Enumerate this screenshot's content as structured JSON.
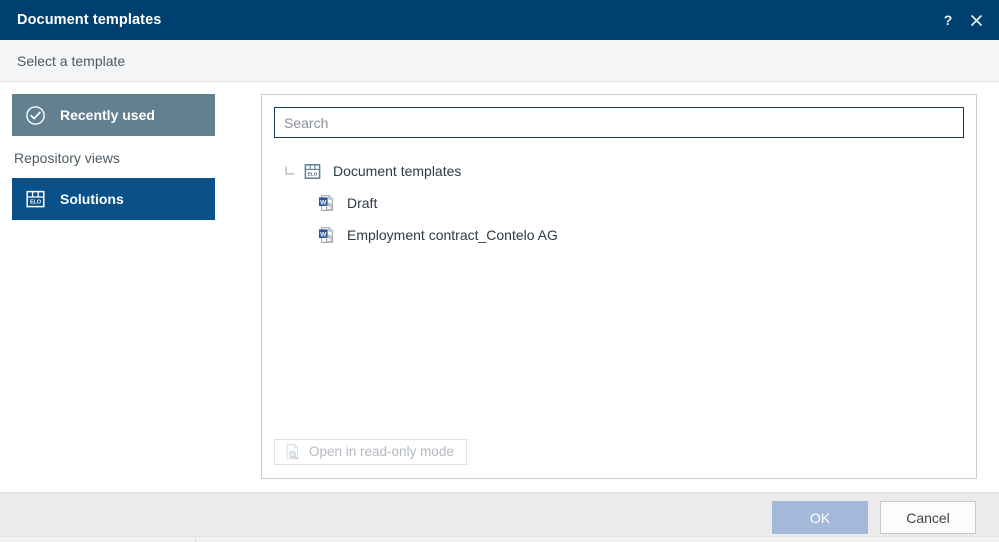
{
  "window": {
    "title": "Document templates",
    "help_icon": "?",
    "help_icon_name": "help-icon",
    "close_icon": "×",
    "close_icon_name": "close-icon",
    "header_color": "#004070"
  },
  "subheader": {
    "text": "Select a template"
  },
  "sidebar": {
    "items": [
      {
        "label": "Recently used",
        "icon": "check-circle-icon",
        "selected": false,
        "color": "#62808f"
      }
    ],
    "section_label": "Repository views",
    "views": [
      {
        "label": "Solutions",
        "icon": "elo-archive-icon",
        "selected": true,
        "color": "#0a5189"
      }
    ]
  },
  "search": {
    "value": "",
    "placeholder": "Search",
    "border_color": "#0d3b63"
  },
  "tree": {
    "nodes": [
      {
        "label": "Document templates",
        "icon": "elo-archive-icon",
        "level": 0,
        "expanded": true,
        "twisty": "collapse-corner-icon"
      },
      {
        "label": "Draft",
        "icon": "word-document-icon",
        "level": 1
      },
      {
        "label": "Employment contract_Contelo AG",
        "icon": "word-document-icon",
        "level": 1
      }
    ]
  },
  "panel_footer": {
    "readonly_button": {
      "label": "Open in read-only mode",
      "icon": "document-preview-icon",
      "disabled": true
    }
  },
  "footer": {
    "ok_label": "OK",
    "ok_disabled": true,
    "ok_color": "#a4b9d9",
    "cancel_label": "Cancel"
  }
}
